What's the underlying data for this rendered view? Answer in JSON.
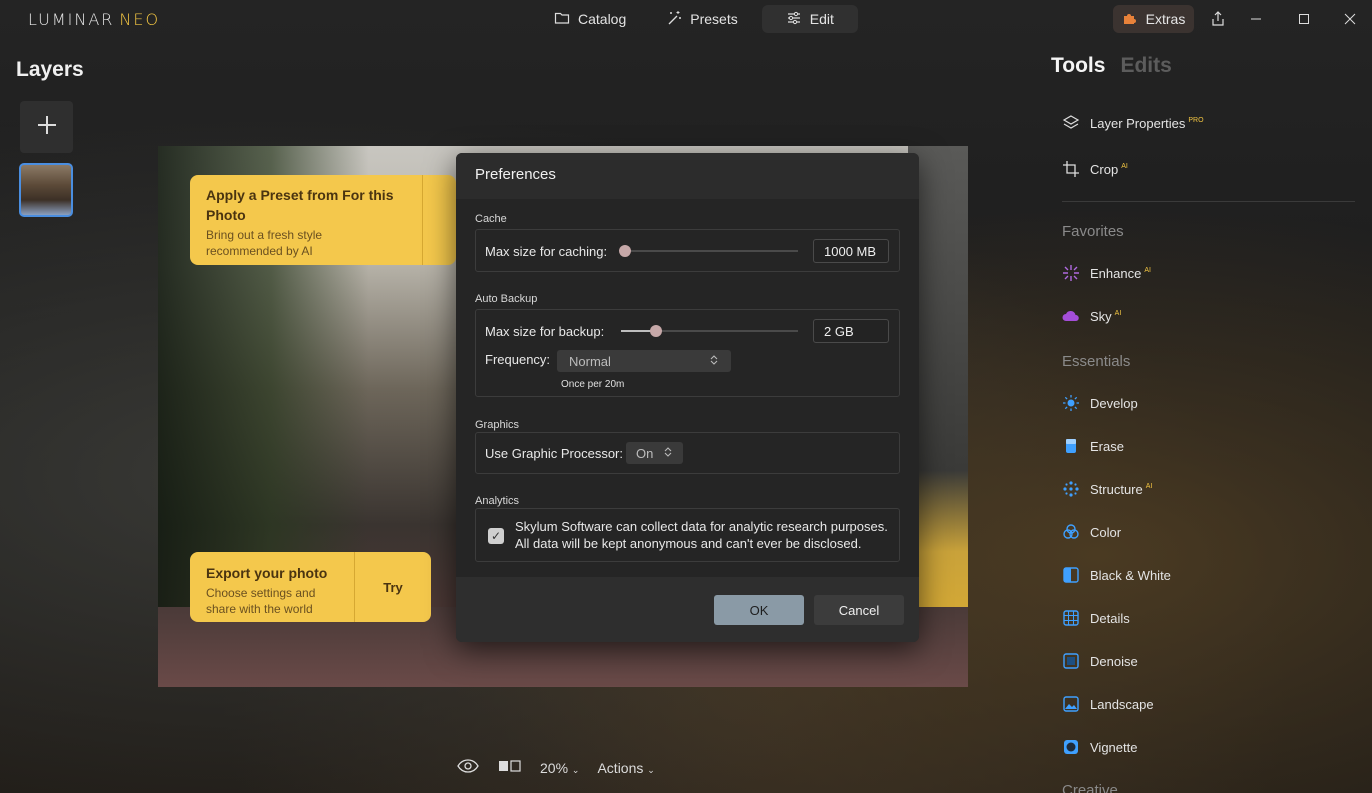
{
  "app": {
    "logo": "LUMINAR",
    "logo_accent": "NEO"
  },
  "nav": {
    "catalog": "Catalog",
    "presets": "Presets",
    "edit": "Edit",
    "extras": "Extras"
  },
  "layers": {
    "title": "Layers"
  },
  "toasts": {
    "preset": {
      "title": "Apply a Preset from For this Photo",
      "sub": "Bring out a fresh style\nrecommended by AI"
    },
    "export": {
      "title": "Export your photo",
      "sub": "Choose settings and\nshare with the world",
      "try": "Try"
    }
  },
  "dialog": {
    "title": "Preferences",
    "cache": {
      "label": "Cache",
      "max_label": "Max size for caching:",
      "value": "1000 MB",
      "level": 0
    },
    "backup": {
      "label": "Auto Backup",
      "max_label": "Max size for backup:",
      "value": "2 GB",
      "level": 0.2,
      "freq_label": "Frequency:",
      "freq_value": "Normal",
      "hint": "Once per 20m"
    },
    "graphics": {
      "label": "Graphics",
      "gpu_label": "Use Graphic Processor:",
      "gpu_value": "On"
    },
    "analytics": {
      "label": "Analytics",
      "text": "Skylum Software can collect data for analytic research purposes. All data will be kept anonymous and can't ever be disclosed.",
      "checked": true
    },
    "ok": "OK",
    "cancel": "Cancel"
  },
  "bottombar": {
    "zoom": "20%",
    "actions": "Actions"
  },
  "tools_panel": {
    "tab_tools": "Tools",
    "tab_edits": "Edits",
    "top": [
      {
        "label": "Layer Properties",
        "badge": "PRO",
        "icon": "layers-icon"
      },
      {
        "label": "Crop",
        "badge": "AI",
        "icon": "crop-icon"
      }
    ],
    "favorites_label": "Favorites",
    "favorites": [
      {
        "label": "Enhance",
        "badge": "AI",
        "icon": "sparkle-icon",
        "color": "#b06ae0"
      },
      {
        "label": "Sky",
        "badge": "AI",
        "icon": "cloud-icon",
        "color": "#a44ed8"
      }
    ],
    "essentials_label": "Essentials",
    "essentials": [
      {
        "label": "Develop",
        "badge": "",
        "icon": "sun-icon"
      },
      {
        "label": "Erase",
        "badge": "",
        "icon": "erase-icon"
      },
      {
        "label": "Structure",
        "badge": "AI",
        "icon": "structure-icon"
      },
      {
        "label": "Color",
        "badge": "",
        "icon": "color-icon"
      },
      {
        "label": "Black & White",
        "badge": "",
        "icon": "bw-icon"
      },
      {
        "label": "Details",
        "badge": "",
        "icon": "details-icon"
      },
      {
        "label": "Denoise",
        "badge": "",
        "icon": "denoise-icon"
      },
      {
        "label": "Landscape",
        "badge": "",
        "icon": "landscape-icon"
      },
      {
        "label": "Vignette",
        "badge": "",
        "icon": "vignette-icon"
      }
    ],
    "creative_label": "Creative"
  }
}
